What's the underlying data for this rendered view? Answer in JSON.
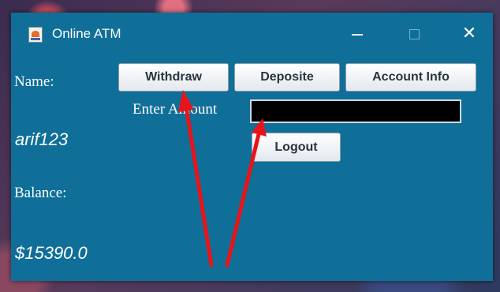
{
  "window": {
    "title": "Online ATM"
  },
  "controls": {
    "minimize": "",
    "maximize": "",
    "close": "✕"
  },
  "labels": {
    "name": "Name:",
    "username": "arif123",
    "balance": "Balance:",
    "balance_value": "$15390.0",
    "enter_amount": "Enter Amount"
  },
  "buttons": {
    "withdraw": "Withdraw",
    "deposite": "Deposite",
    "account_info": "Account Info",
    "logout": "Logout"
  },
  "amount_input": {
    "value": "",
    "placeholder": ""
  },
  "colors": {
    "window_bg": "#0f6f99",
    "arrow": "#e8141a",
    "input_bg": "#000000"
  },
  "annotations": {
    "arrow_count": 2
  }
}
